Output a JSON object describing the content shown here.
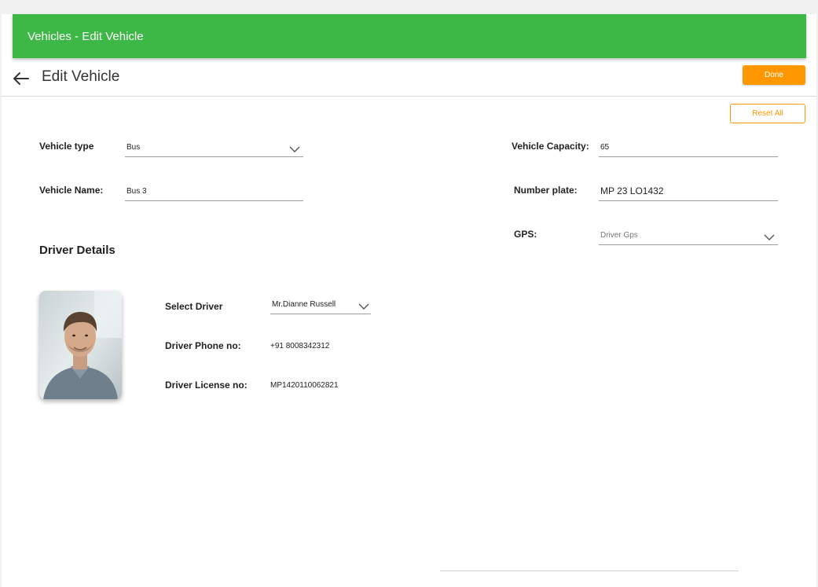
{
  "app": {
    "title": "Vehicles - Edit Vehicle"
  },
  "header": {
    "title": "Edit Vehicle",
    "back_icon": "arrow-left-icon"
  },
  "actions": {
    "done_label": "Done",
    "reset_label": "Reset All"
  },
  "colors": {
    "topbar": "#3db846",
    "accent": "#ff9800"
  },
  "vehicle": {
    "type_label": "Vehicle type",
    "type_value": "Bus",
    "name_label": "Vehicle Name:",
    "name_value": "Bus 3",
    "capacity_label": "Vehicle Capacity:",
    "capacity_value": "65",
    "plate_label": "Number plate:",
    "plate_value": "MP 23 LO1432",
    "gps_label": "GPS:",
    "gps_value": "Driver Gps"
  },
  "driver": {
    "section_title": "Driver Details",
    "select_label": "Select Driver",
    "select_value": "Mr.Dianne Russell",
    "phone_label": "Driver Phone no:",
    "phone_value": "+91 8008342312",
    "license_label": "Driver License no:",
    "license_value": "MP1420110062821"
  }
}
